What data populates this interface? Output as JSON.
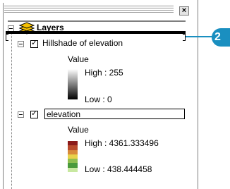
{
  "toc": {
    "close_glyph": "×",
    "layers_group": {
      "label": "Layers",
      "icon": "layers-icon"
    },
    "layers": [
      {
        "name": "Hillshade of elevation",
        "checked": true,
        "legend_heading": "Value",
        "high_label": "High : 255",
        "low_label": "Low : 0"
      },
      {
        "name": "elevation",
        "checked": true,
        "legend_heading": "Value",
        "high_label": "High : 4361.333496",
        "low_label": "Low : 438.444458"
      }
    ]
  },
  "callout": {
    "number": "2"
  },
  "colors": {
    "callout": "#1a8fc0",
    "ramp": [
      "#8b1a1a",
      "#b94a2c",
      "#d88a3a",
      "#e8d24a",
      "#8fbf4f",
      "#4a9a3a",
      "#c8e8a0"
    ]
  }
}
